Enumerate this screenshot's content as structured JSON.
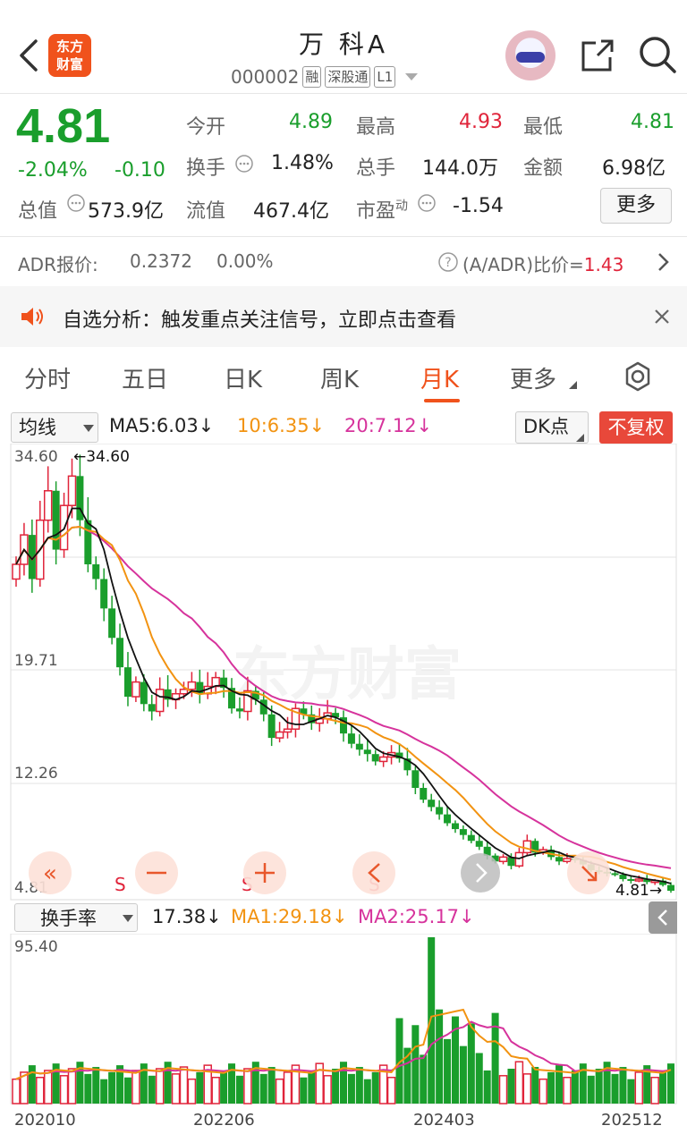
{
  "header": {
    "back_icon": "chevron-left-icon",
    "logo_line1": "东方",
    "logo_line2": "财富",
    "title": "万 科A",
    "code": "000002",
    "tags": [
      "融",
      "深股通",
      "L1"
    ],
    "share_icon": "share-icon",
    "search_icon": "search-icon"
  },
  "quote": {
    "price": "4.81",
    "change_pct": "-2.04%",
    "change": "-0.10",
    "open_label": "今开",
    "open": "4.89",
    "high_label": "最高",
    "high": "4.93",
    "low_label": "最低",
    "low": "4.81",
    "turnover_label": "换手",
    "turnover": "1.48%",
    "volume_label": "总手",
    "volume": "144.0万",
    "amount_label": "金额",
    "amount": "6.98亿",
    "total_value_label": "总值",
    "total_value": "573.9亿",
    "float_value_label": "流值",
    "float_value": "467.4亿",
    "pe_label": "市盈",
    "pe_sup": "动",
    "pe": "-1.54",
    "more_label": "更多"
  },
  "adr": {
    "label": "ADR报价:",
    "price": "0.2372",
    "pct": "0.00%",
    "ratio_label": "(A/ADR)比价=",
    "ratio": "1.43"
  },
  "notice": {
    "text": "自选分析：触发重点关注信号，立即点击查看"
  },
  "tabs": [
    "分时",
    "五日",
    "日K",
    "周K",
    "月K",
    "更多"
  ],
  "active_tab": "月K",
  "kline": {
    "ma_select": "均线",
    "ma5": "MA5:6.03↓",
    "ma10": "10:6.35↓",
    "ma20": "20:7.12↓",
    "dk_label": "DK点",
    "fq_label": "不复权",
    "y_high": "34.60",
    "high_marker": "←34.60",
    "y_mid1": "19.71",
    "y_mid2": "12.26",
    "y_low": "4.81",
    "low_marker": "4.81→",
    "watermark": "东方财富",
    "signals": [
      "S",
      "S",
      "S"
    ]
  },
  "volume_panel": {
    "select": "换手率",
    "value": "17.38↓",
    "ma1": "MA1:29.18↓",
    "ma2": "MA2:25.17↓",
    "y_max": "95.40",
    "x_labels": [
      "202010",
      "202206",
      "202403",
      "202512"
    ]
  },
  "colors": {
    "up": "#e0243a",
    "down": "#1a9e2c",
    "ma5": "#111111",
    "ma10": "#f29311",
    "ma20": "#d6339c",
    "accent": "#f0521c"
  }
}
